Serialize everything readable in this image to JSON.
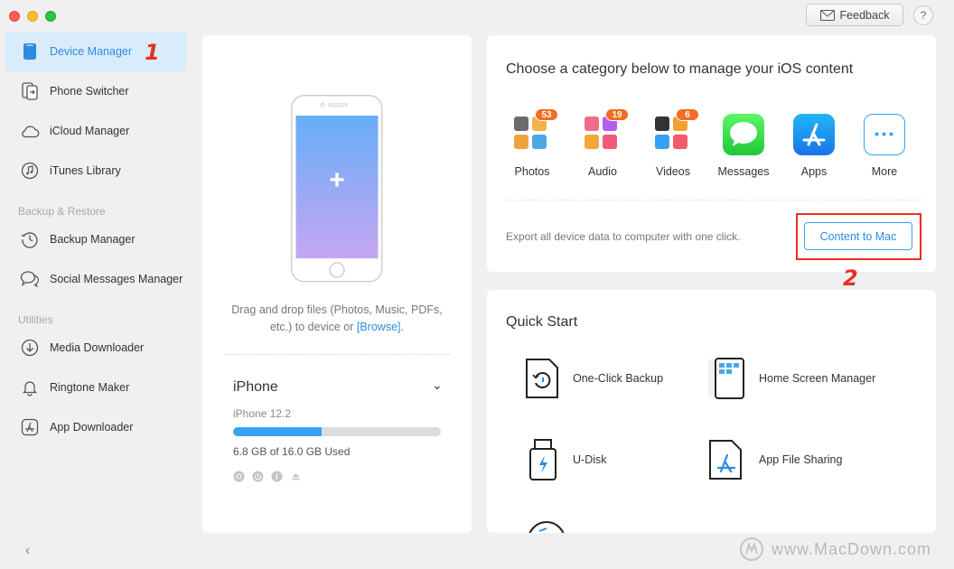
{
  "header": {
    "feedback_label": "Feedback",
    "help_label": "?"
  },
  "sidebar": {
    "items": [
      {
        "label": "Device Manager",
        "icon": "phone-icon",
        "active": true
      },
      {
        "label": "Phone Switcher",
        "icon": "phone-switch-icon"
      },
      {
        "label": "iCloud Manager",
        "icon": "cloud-icon"
      },
      {
        "label": "iTunes Library",
        "icon": "music-note-icon"
      },
      {
        "label": "Backup Manager",
        "icon": "history-icon"
      },
      {
        "label": "Social Messages Manager",
        "icon": "chat-bubbles-icon"
      },
      {
        "label": "Media Downloader",
        "icon": "download-icon"
      },
      {
        "label": "Ringtone Maker",
        "icon": "bell-icon"
      },
      {
        "label": "App Downloader",
        "icon": "app-store-icon"
      }
    ],
    "sections": {
      "backup": "Backup & Restore",
      "utilities": "Utilities"
    },
    "collapse_glyph": "‹"
  },
  "annotations": {
    "step1": "1",
    "step2": "2"
  },
  "device_panel": {
    "drop_text": "Drag and drop files (Photos, Music, PDFs, etc.) to device or",
    "browse_link": "[Browse]",
    "drop_tail": ".",
    "device_name": "iPhone",
    "model": "iPhone 12.2",
    "storage_text": "6.8 GB of  16.0 GB Used",
    "storage_used_fraction": 0.425,
    "plus_glyph": "+",
    "dropdown_glyph": "⌄"
  },
  "category": {
    "title": "Choose a category below to manage your iOS content",
    "items": [
      {
        "label": "Photos",
        "badge": "53",
        "icon": "photos-icon"
      },
      {
        "label": "Audio",
        "badge": "19",
        "icon": "audio-icon"
      },
      {
        "label": "Videos",
        "badge": "6",
        "icon": "videos-icon"
      },
      {
        "label": "Messages",
        "icon": "messages-icon"
      },
      {
        "label": "Apps",
        "icon": "apps-icon"
      },
      {
        "label": "More",
        "icon": "more-icon"
      }
    ],
    "export_text": "Export all device data to computer with one click.",
    "content_to_mac": "Content to Mac"
  },
  "quick_start": {
    "title": "Quick Start",
    "items": [
      {
        "label": "One-Click Backup",
        "icon": "backup-icon"
      },
      {
        "label": "Home Screen Manager",
        "icon": "home-screen-icon"
      },
      {
        "label": "U-Disk",
        "icon": "usb-icon"
      },
      {
        "label": "App File Sharing",
        "icon": "app-file-icon"
      }
    ]
  },
  "watermark": "www.MacDown.com",
  "colors": {
    "accent": "#2b8be1",
    "annotation": "#e8301f",
    "badge": "#f26d21"
  }
}
